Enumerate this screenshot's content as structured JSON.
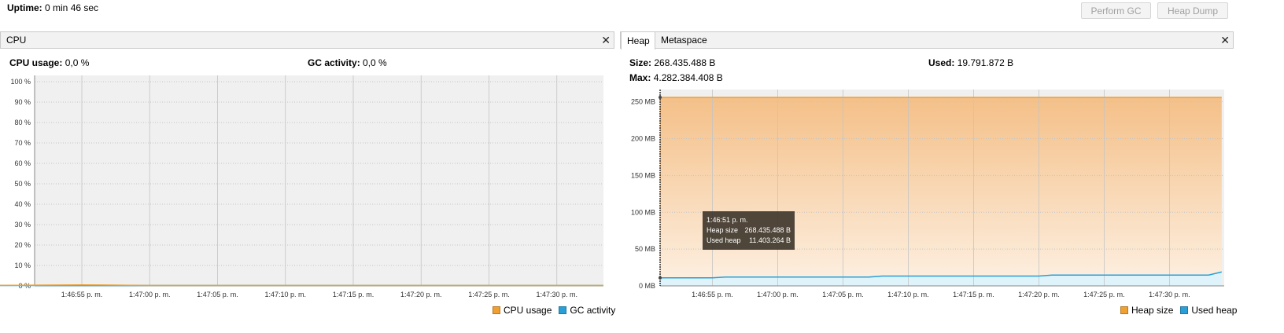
{
  "header": {
    "uptime_label": "Uptime:",
    "uptime_value": "0 min 46 sec",
    "perform_gc_label": "Perform GC",
    "heap_dump_label": "Heap Dump"
  },
  "cpu_panel": {
    "tab_label": "CPU",
    "close_glyph": "✕",
    "cpu_usage_label": "CPU usage:",
    "cpu_usage_value": "0,0 %",
    "gc_activity_label": "GC activity:",
    "gc_activity_value": "0,0 %",
    "legend": [
      {
        "label": "CPU usage",
        "color": "#f0a030"
      },
      {
        "label": "GC activity",
        "color": "#2a9fd6"
      }
    ]
  },
  "memory_panel": {
    "tabs": [
      {
        "label": "Heap",
        "selected": true
      },
      {
        "label": "Metaspace",
        "selected": false
      }
    ],
    "close_glyph": "✕",
    "size_label": "Size:",
    "size_value": "268.435.488 B",
    "used_label": "Used:",
    "used_value": "19.791.872 B",
    "max_label": "Max:",
    "max_value": "4.282.384.408 B",
    "tooltip": {
      "time": "1:46:51 p. m.",
      "heap_size_label": "Heap size",
      "heap_size_value": "268.435.488 B",
      "used_heap_label": "Used heap",
      "used_heap_value": "11.403.264 B"
    },
    "legend": [
      {
        "label": "Heap size",
        "color": "#f0a030"
      },
      {
        "label": "Used heap",
        "color": "#2a9fd6"
      }
    ]
  },
  "chart_data": [
    {
      "type": "line",
      "x_tick_labels": [
        "1:46:55 p. m.",
        "1:47:00 p. m.",
        "1:47:05 p. m.",
        "1:47:10 p. m.",
        "1:47:15 p. m.",
        "1:47:20 p. m.",
        "1:47:25 p. m.",
        "1:47:30 p. m."
      ],
      "y_tick_labels": [
        "0 %",
        "10 %",
        "20 %",
        "30 %",
        "40 %",
        "50 %",
        "60 %",
        "70 %",
        "80 %",
        "90 %",
        "100 %"
      ],
      "ylim": [
        0,
        100
      ],
      "x_seconds_from_first_tick": [
        -7,
        0,
        5,
        10,
        15,
        20,
        25,
        30,
        35,
        40
      ],
      "series": [
        {
          "name": "CPU usage",
          "values": [
            0,
            0.3,
            0,
            0,
            0,
            0,
            0,
            0,
            0,
            0
          ]
        },
        {
          "name": "GC activity",
          "values": [
            0,
            0,
            0,
            0,
            0,
            0,
            0,
            0,
            0,
            0
          ]
        }
      ],
      "grid": true,
      "legend_position": "bottom-right"
    },
    {
      "type": "area",
      "x_tick_labels": [
        "1:46:55 p. m.",
        "1:47:00 p. m.",
        "1:47:05 p. m.",
        "1:47:10 p. m.",
        "1:47:15 p. m.",
        "1:47:20 p. m.",
        "1:47:25 p. m.",
        "1:47:30 p. m."
      ],
      "y_tick_labels": [
        "0 MB",
        "50 MB",
        "100 MB",
        "150 MB",
        "200 MB",
        "250 MB"
      ],
      "ylim": [
        0,
        256
      ],
      "series": [
        {
          "name": "Heap size",
          "points": [
            [
              "1:46:51",
              256
            ],
            [
              "1:47:34",
              256
            ]
          ]
        },
        {
          "name": "Used heap",
          "points": [
            [
              "1:46:51",
              10.9
            ],
            [
              "1:46:55",
              10.9
            ],
            [
              "1:46:56",
              12.0
            ],
            [
              "1:47:07",
              12.0
            ],
            [
              "1:47:08",
              13.3
            ],
            [
              "1:47:20",
              13.3
            ],
            [
              "1:47:21",
              14.7
            ],
            [
              "1:47:33",
              14.7
            ],
            [
              "1:47:34",
              18.9
            ]
          ]
        }
      ],
      "grid": true,
      "legend_position": "bottom-right"
    }
  ]
}
